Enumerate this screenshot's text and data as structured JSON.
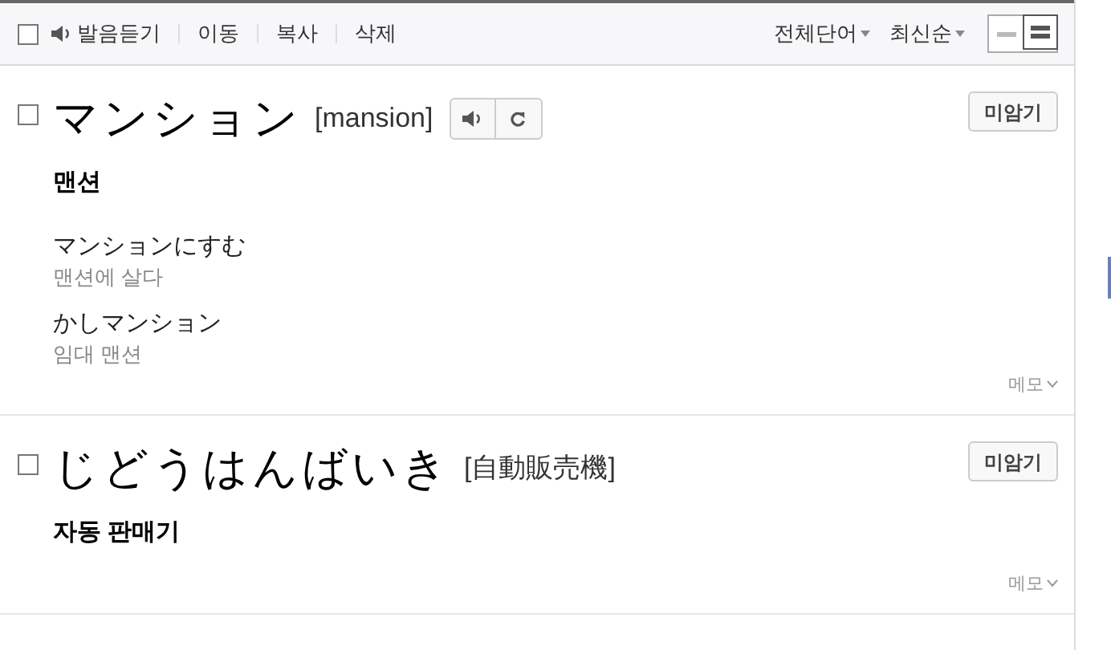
{
  "toolbar": {
    "select_all_checked": false,
    "actions": [
      "발음듣기",
      "이동",
      "복사",
      "삭제"
    ],
    "filters": [
      "전체단어",
      "최신순"
    ],
    "view_modes": [
      {
        "kind": "compact",
        "selected": false
      },
      {
        "kind": "detail",
        "selected": true
      }
    ]
  },
  "entries": [
    {
      "checked": false,
      "word": "マンション",
      "reading": "[mansion]",
      "audio": true,
      "meaning": "맨션",
      "examples": [
        {
          "text": "マンションにすむ",
          "translation": "맨션에 살다"
        },
        {
          "text": "かしマンション",
          "translation": "임대 맨션"
        }
      ],
      "button": "미암기",
      "memo": "메모"
    },
    {
      "checked": false,
      "word": "じどうはんばいき",
      "reading": "[自動販売機]",
      "audio": false,
      "meaning": "자동 판매기",
      "button": "미암기",
      "memo": "메모"
    }
  ]
}
